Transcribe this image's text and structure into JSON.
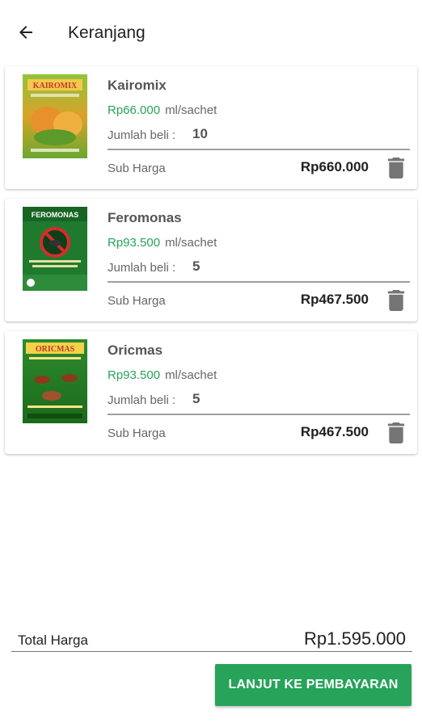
{
  "appbar": {
    "title": "Keranjang",
    "back_icon": "arrow-left-icon"
  },
  "cart_items": [
    {
      "name": "Kairomix",
      "price": "Rp66.000",
      "unit": "ml/sachet",
      "qty_label": "Jumlah beli :",
      "qty": "10",
      "subtotal_label": "Sub Harga",
      "subtotal": "Rp660.000",
      "delete_icon": "trash-icon",
      "image_label": "KAIROMIX"
    },
    {
      "name": "Feromonas",
      "price": "Rp93.500",
      "unit": "ml/sachet",
      "qty_label": "Jumlah beli :",
      "qty": "5",
      "subtotal_label": "Sub Harga",
      "subtotal": "Rp467.500",
      "delete_icon": "trash-icon",
      "image_label": "FEROMONAS"
    },
    {
      "name": "Oricmas",
      "price": "Rp93.500",
      "unit": "ml/sachet",
      "qty_label": "Jumlah beli :",
      "qty": "5",
      "subtotal_label": "Sub Harga",
      "subtotal": "Rp467.500",
      "delete_icon": "trash-icon",
      "image_label": "ORICMAS"
    }
  ],
  "footer": {
    "total_label": "Total Harga",
    "total_value": "Rp1.595.000",
    "checkout_label": "LANJUT KE PEMBAYARAN"
  },
  "colors": {
    "accent_green": "#27a35a",
    "delete_grey": "#757575"
  }
}
